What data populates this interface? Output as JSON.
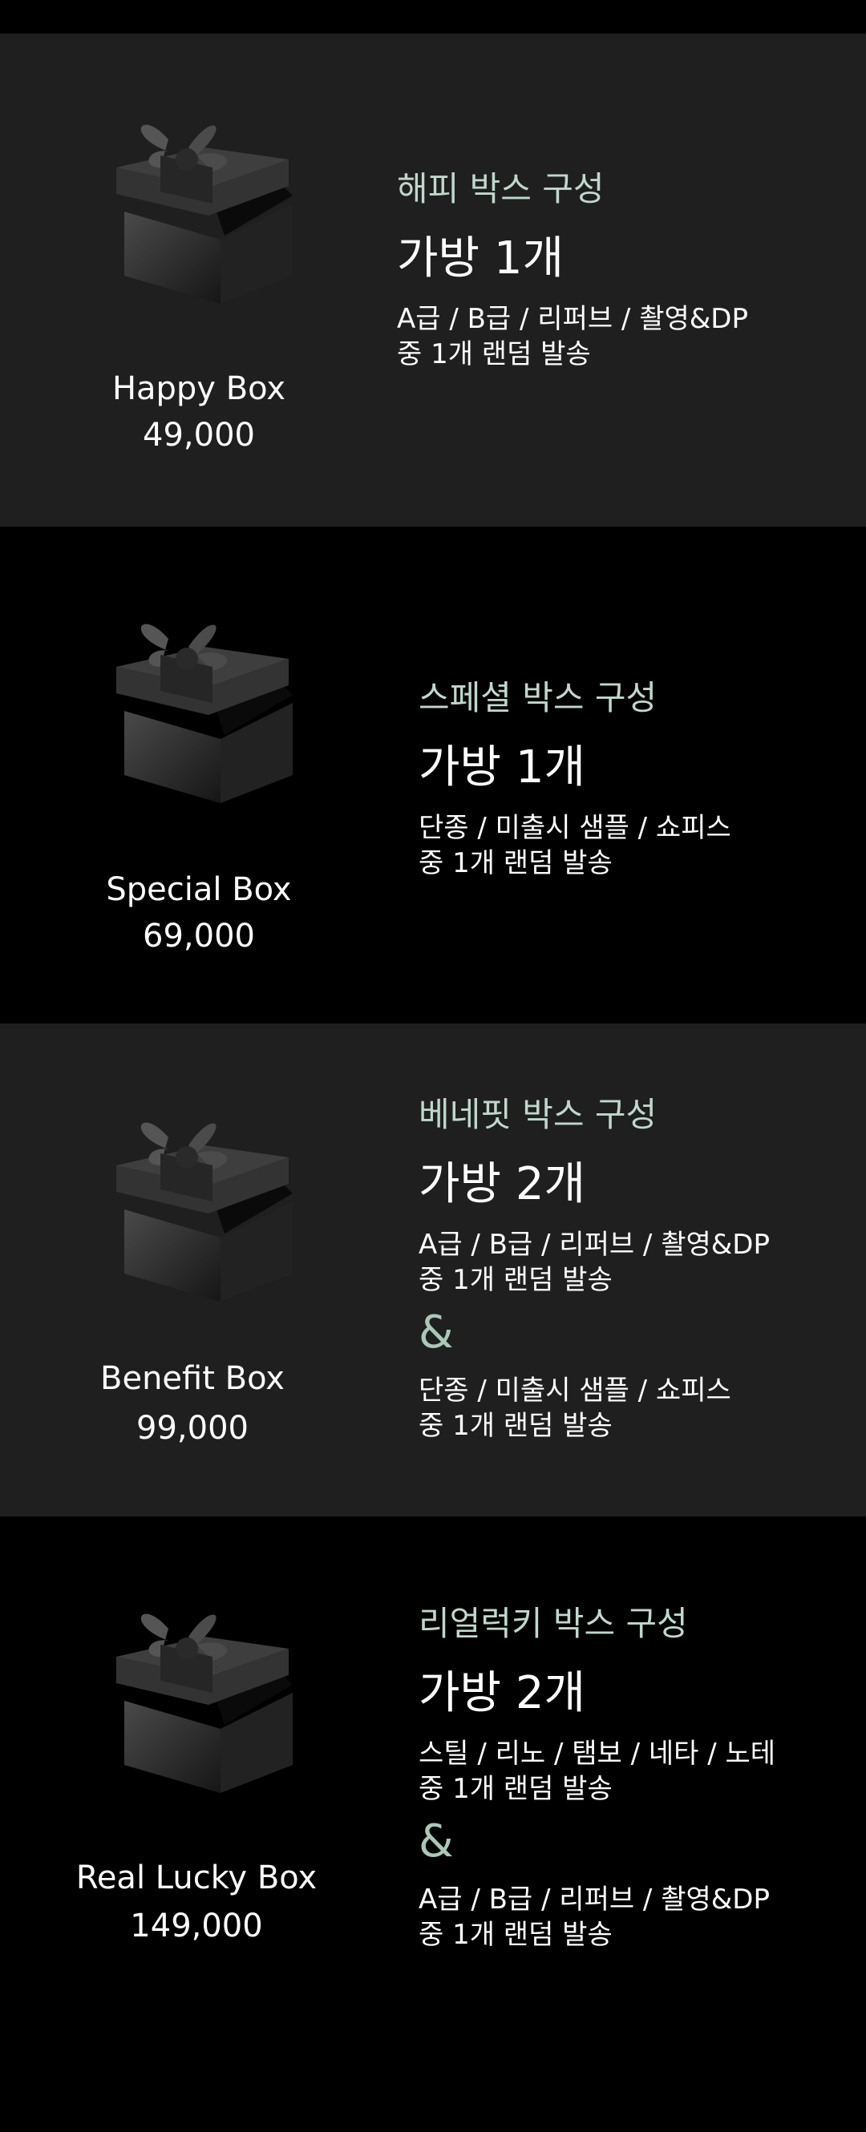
{
  "colors": {
    "dark_bg": "#1f1f1f",
    "black_bg": "#000000",
    "accent": "#bfd8cb"
  },
  "boxes": [
    {
      "icon": "gift-box-icon",
      "name": "Happy Box",
      "price": "49,000",
      "heading": "해피 박스 구성",
      "count": "가방 1개",
      "desc1": [
        "A급 / B급 / 리퍼브 / 촬영&DP",
        "중 1개 랜덤 발송"
      ]
    },
    {
      "icon": "gift-box-icon",
      "name": "Special Box",
      "price": "69,000",
      "heading": "스페셜 박스 구성",
      "count": "가방 1개",
      "desc1": [
        "단종 / 미출시 샘플 / 쇼피스",
        "중 1개 랜덤 발송"
      ]
    },
    {
      "icon": "gift-box-icon",
      "name": "Benefit Box",
      "price": "99,000",
      "heading": "베네핏 박스 구성",
      "count": "가방 2개",
      "desc1": [
        "A급 / B급 / 리퍼브 / 촬영&DP",
        "중 1개 랜덤 발송"
      ],
      "amp": "&",
      "desc2": [
        "단종 / 미출시 샘플 / 쇼피스",
        "중 1개 랜덤 발송"
      ]
    },
    {
      "icon": "gift-box-icon",
      "name": "Real Lucky Box",
      "price": "149,000",
      "heading": "리얼럭키 박스 구성",
      "count": "가방 2개",
      "desc1": [
        "스틸 / 리노 / 탬보 / 네타 / 노테",
        "중 1개 랜덤 발송"
      ],
      "amp": "&",
      "desc2": [
        "A급 / B급 / 리퍼브 / 촬영&DP",
        "중 1개 랜덤 발송"
      ]
    }
  ]
}
